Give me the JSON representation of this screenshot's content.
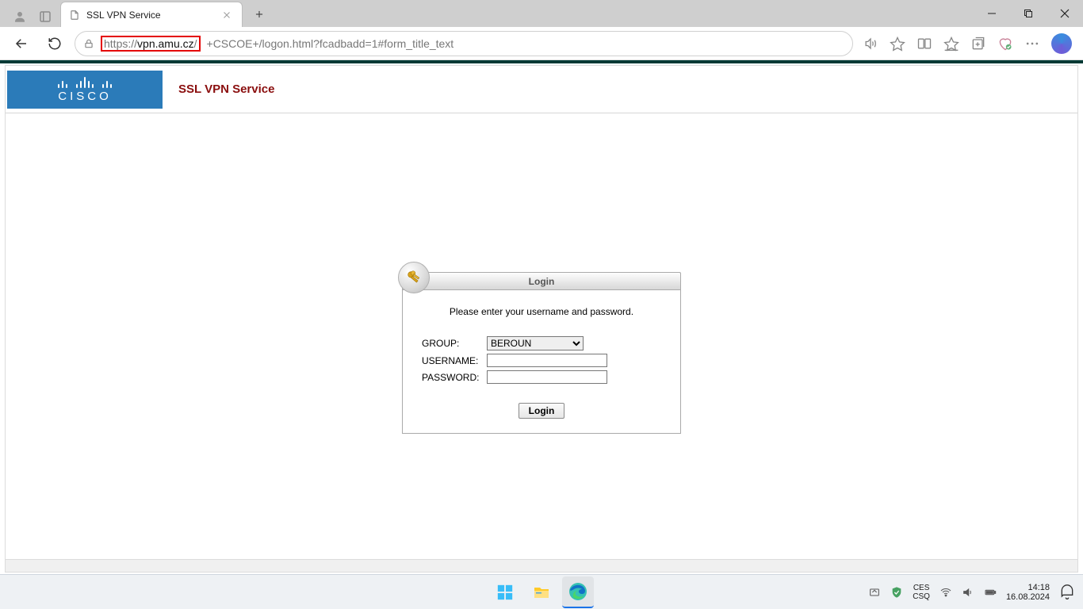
{
  "browser": {
    "tab_title": "SSL VPN Service",
    "url_highlighted": "https://vpn.amu.cz/",
    "url_rest": "+CSCOE+/logon.html?fcadbadd=1#form_title_text"
  },
  "page": {
    "brand_service": "SSL VPN Service",
    "cisco_word": "CISCO",
    "login_header": "Login",
    "login_message": "Please enter your username and password.",
    "labels": {
      "group": "GROUP:",
      "username": "USERNAME:",
      "password": "PASSWORD:"
    },
    "group_selected": "BEROUN",
    "login_button": "Login"
  },
  "taskbar": {
    "lang_top": "CES",
    "lang_bottom": "CSQ",
    "time": "14:18",
    "date": "16.08.2024"
  }
}
